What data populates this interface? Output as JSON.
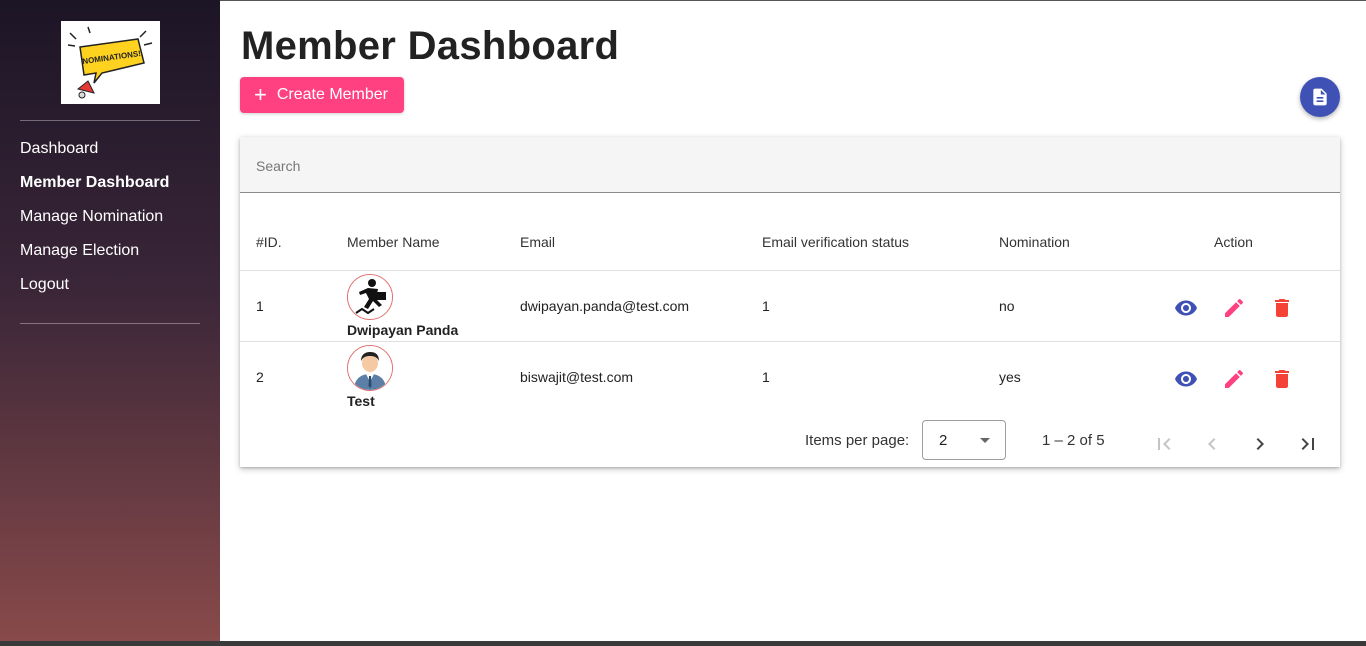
{
  "sidebar": {
    "logo_text": "NOMINATIONS!",
    "items": [
      {
        "label": "Dashboard",
        "active": false
      },
      {
        "label": "Member Dashboard",
        "active": true
      },
      {
        "label": "Manage Nomination",
        "active": false
      },
      {
        "label": "Manage Election",
        "active": false
      },
      {
        "label": "Logout",
        "active": false
      }
    ]
  },
  "header": {
    "title": "Member Dashboard",
    "create_label": "Create Member",
    "create_icon": "plus-icon",
    "fab_icon": "document-icon"
  },
  "search": {
    "placeholder": "Search"
  },
  "table": {
    "columns": [
      "#ID.",
      "Member Name",
      "Email",
      "Email verification status",
      "Nomination",
      "Action"
    ],
    "rows": [
      {
        "id": "1",
        "name": "Dwipayan Panda",
        "email": "dwipayan.panda@test.com",
        "verification": "1",
        "nomination": "no"
      },
      {
        "id": "2",
        "name": "Test",
        "email": "biswajit@test.com",
        "verification": "1",
        "nomination": "yes"
      }
    ],
    "action_icons": [
      "eye-icon",
      "pencil-icon",
      "trash-icon"
    ]
  },
  "pagination": {
    "items_label": "Items per page:",
    "page_size": "2",
    "range": "1 – 2 of 5",
    "buttons": [
      "first-page-icon",
      "prev-page-icon",
      "next-page-icon",
      "last-page-icon"
    ]
  },
  "colors": {
    "accent": "#ff4081",
    "primary": "#3f51b5",
    "warn": "#f44336",
    "sidebar_top": "#1c1526",
    "sidebar_bottom": "#884a4a"
  }
}
